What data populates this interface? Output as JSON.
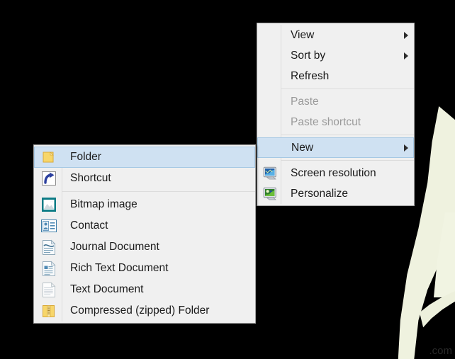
{
  "desktop": {
    "watermark": ".com",
    "background_color": "#000000",
    "shape_color": "#f0f3e1"
  },
  "theme": {
    "menu_background": "#f0f0f0",
    "menu_border": "#a0a0a0",
    "highlight_fill": "#cfe1f2",
    "highlight_border": "#a6c8e4",
    "text_color": "#1b1b1b",
    "disabled_text_color": "#9a9a9a",
    "separator_color": "#dcdcdc"
  },
  "context_menu": {
    "name": "desktop-context-menu",
    "items": [
      {
        "label": "View",
        "icon": "none",
        "submenu": true,
        "disabled": false,
        "selected": false
      },
      {
        "label": "Sort by",
        "icon": "none",
        "submenu": true,
        "disabled": false,
        "selected": false
      },
      {
        "label": "Refresh",
        "icon": "none",
        "submenu": false,
        "disabled": false,
        "selected": false
      },
      {
        "label": "Paste",
        "icon": "none",
        "submenu": false,
        "disabled": true,
        "selected": false
      },
      {
        "label": "Paste shortcut",
        "icon": "none",
        "submenu": false,
        "disabled": true,
        "selected": false
      },
      {
        "label": "New",
        "icon": "none",
        "submenu": true,
        "disabled": false,
        "selected": true
      },
      {
        "label": "Screen resolution",
        "icon": "monitor-blue-icon",
        "submenu": false,
        "disabled": false,
        "selected": false
      },
      {
        "label": "Personalize",
        "icon": "monitor-green-icon",
        "submenu": false,
        "disabled": false,
        "selected": false
      }
    ],
    "separators_after": [
      2,
      4,
      5
    ]
  },
  "new_submenu": {
    "name": "new-submenu",
    "items": [
      {
        "label": "Folder",
        "icon": "folder-icon",
        "selected": true
      },
      {
        "label": "Shortcut",
        "icon": "shortcut-icon",
        "selected": false
      },
      {
        "label": "Bitmap image",
        "icon": "bitmap-image-icon",
        "selected": false
      },
      {
        "label": "Contact",
        "icon": "contact-icon",
        "selected": false
      },
      {
        "label": "Journal Document",
        "icon": "journal-icon",
        "selected": false
      },
      {
        "label": "Rich Text Document",
        "icon": "rich-text-icon",
        "selected": false
      },
      {
        "label": "Text Document",
        "icon": "text-document-icon",
        "selected": false
      },
      {
        "label": "Compressed (zipped) Folder",
        "icon": "zipped-folder-icon",
        "selected": false
      }
    ],
    "separators_after": [
      1
    ]
  }
}
